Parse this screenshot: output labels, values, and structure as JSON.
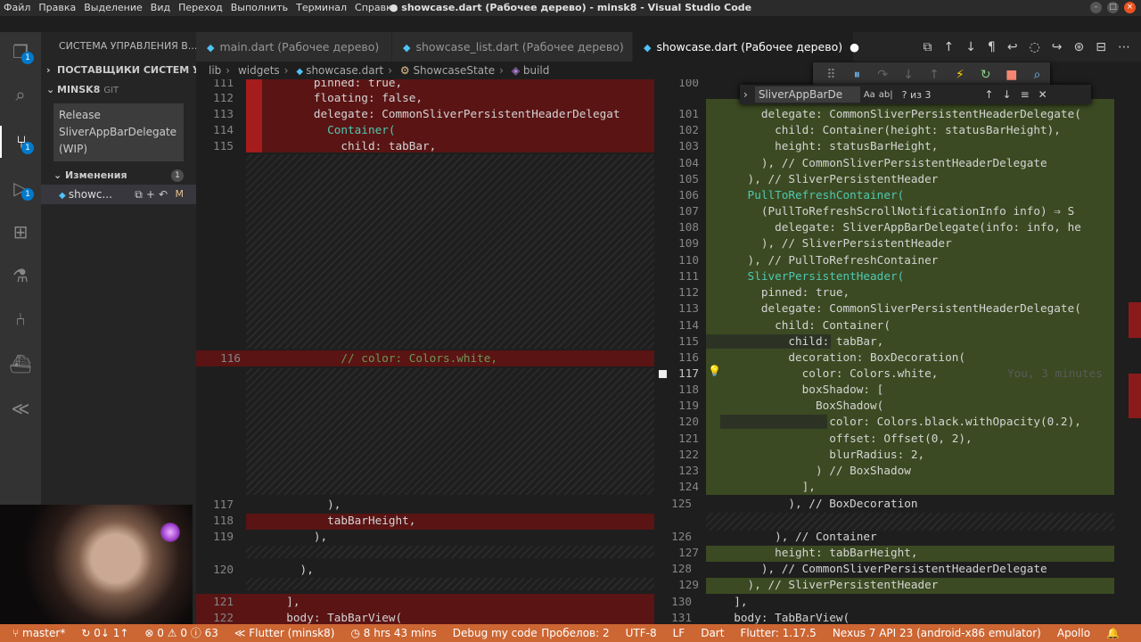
{
  "titlebar": {
    "menu": [
      "Файл",
      "Правка",
      "Выделение",
      "Вид",
      "Переход",
      "Выполнить",
      "Терминал",
      "Справка"
    ],
    "title": "● showcase.dart (Рабочее дерево) - minsk8 - Visual Studio Code"
  },
  "activitybar": {
    "icons": [
      "explorer-icon",
      "search-icon",
      "source-control-icon",
      "debug-icon",
      "extensions-icon",
      "flask-icon",
      "git-graph-icon",
      "docker-icon",
      "flutter-icon"
    ],
    "badges": {
      "explorer": "1",
      "source_control": "1",
      "debug": "1"
    }
  },
  "sidebar": {
    "title": "СИСТЕМА УПРАВЛЕНИЯ В...",
    "providers": "ПОСТАВЩИКИ СИСТЕМ УП...",
    "repo": "MINSK8",
    "repo_tag": "GIT",
    "commit_message": "Release SliverAppBarDelegate (WIP)",
    "changes_label": "Изменения",
    "changes_count": "1",
    "change_file": "showc...",
    "change_status": "M"
  },
  "tabs": [
    {
      "label": "main.dart (Рабочее дерево)",
      "active": false
    },
    {
      "label": "showcase_list.dart (Рабочее дерево)",
      "active": false
    },
    {
      "label": "showcase.dart (Рабочее дерево)",
      "active": true,
      "dirty": "●"
    }
  ],
  "breadcrumb": [
    "lib",
    "widgets",
    "showcase.dart",
    "ShowcaseState",
    "build"
  ],
  "find": {
    "query": "SliverAppBarDe",
    "case": "Aa",
    "word": "ab|",
    "result": "? из 3"
  },
  "left_lines": [
    {
      "n": "111",
      "t": "      pinned: true,"
    },
    {
      "n": "112",
      "t": "      floating: false,"
    },
    {
      "n": "113",
      "t": "      delegate: CommonSliverPersistentHeaderDelegat"
    },
    {
      "n": "114",
      "t": "        Container("
    },
    {
      "n": "115",
      "t": "          child: tabBar,"
    },
    {
      "n": "116",
      "t": "          // color: Colors.white,"
    },
    {
      "n": "117",
      "t": "        ),"
    },
    {
      "n": "118",
      "t": "        tabBarHeight,"
    },
    {
      "n": "119",
      "t": "      ),"
    },
    {
      "n": "120",
      "t": "    ),"
    },
    {
      "n": "121",
      "t": "  ],"
    },
    {
      "n": "122",
      "t": "  body: TabBarView("
    }
  ],
  "right_lines": [
    {
      "n": "100",
      "t": ""
    },
    {
      "n": "101",
      "t": "      delegate: CommonSliverPersistentHeaderDelegate("
    },
    {
      "n": "102",
      "t": "        child: Container(height: statusBarHeight),"
    },
    {
      "n": "103",
      "t": "        height: statusBarHeight,"
    },
    {
      "n": "104",
      "t": "      ), // CommonSliverPersistentHeaderDelegate"
    },
    {
      "n": "105",
      "t": "    ), // SliverPersistentHeader"
    },
    {
      "n": "106",
      "t": "    PullToRefreshContainer("
    },
    {
      "n": "107",
      "t": "      (PullToRefreshScrollNotificationInfo info) ⇒ S"
    },
    {
      "n": "108",
      "t": "        delegate: SliverAppBarDelegate(info: info, he"
    },
    {
      "n": "109",
      "t": "      ), // SliverPersistentHeader"
    },
    {
      "n": "110",
      "t": "    ), // PullToRefreshContainer"
    },
    {
      "n": "111",
      "t": "    SliverPersistentHeader("
    },
    {
      "n": "112",
      "t": "      pinned: true,"
    },
    {
      "n": "113",
      "t": "      delegate: CommonSliverPersistentHeaderDelegate("
    },
    {
      "n": "114",
      "t": "        child: Container("
    },
    {
      "n": "115",
      "t": "          child: tabBar,"
    },
    {
      "n": "116",
      "t": "          decoration: BoxDecoration("
    },
    {
      "n": "117",
      "t": "            color: Colors.white,"
    },
    {
      "n": "118",
      "t": "            boxShadow: ["
    },
    {
      "n": "119",
      "t": "              BoxShadow("
    },
    {
      "n": "120",
      "t": "                color: Colors.black.withOpacity(0.2),"
    },
    {
      "n": "121",
      "t": "                offset: Offset(0, 2),"
    },
    {
      "n": "122",
      "t": "                blurRadius: 2,"
    },
    {
      "n": "123",
      "t": "              ) // BoxShadow"
    },
    {
      "n": "124",
      "t": "            ],"
    },
    {
      "n": "125",
      "t": "          ), // BoxDecoration"
    },
    {
      "n": "126",
      "t": "        ), // Container"
    },
    {
      "n": "127",
      "t": "        height: tabBarHeight,"
    },
    {
      "n": "128",
      "t": "      ), // CommonSliverPersistentHeaderDelegate"
    },
    {
      "n": "129",
      "t": "    ), // SliverPersistentHeader"
    },
    {
      "n": "130",
      "t": "  ],"
    },
    {
      "n": "131",
      "t": "  body: TabBarView("
    }
  ],
  "blame": "You, 3 minutes",
  "statusbar": {
    "branch": "master*",
    "sync": "0↓ 1↑",
    "problems": "⊗ 0 ⚠ 0 ⓘ 63",
    "flutter": "Flutter (minsk8)",
    "time": "8 hrs 43 mins",
    "debug": "Debug my code",
    "spaces": "Пробелов: 2",
    "encoding": "UTF-8",
    "eol": "LF",
    "language": "Dart",
    "flutter_version": "Flutter: 1.17.5",
    "device": "Nexus 7 API 23 (android-x86 emulator)",
    "apollo": "Apollo"
  }
}
